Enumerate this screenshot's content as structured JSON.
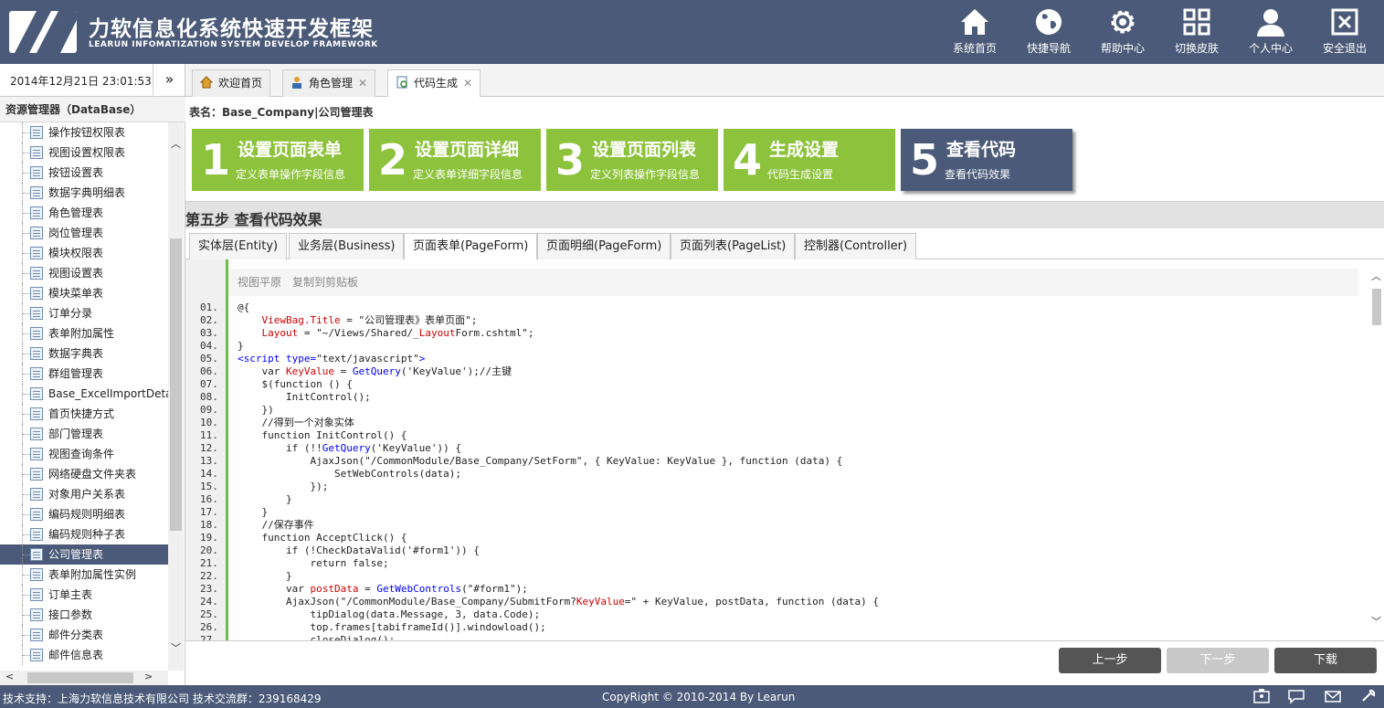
{
  "app": {
    "title": "力软信息化系统快速开发框架",
    "subtitle": "LEARUN INFOMATIZATION SYSTEM DEVELOP FRAMEWORK"
  },
  "nav": [
    {
      "label": "系统首页",
      "icon": "home-icon"
    },
    {
      "label": "快捷导航",
      "icon": "globe-icon"
    },
    {
      "label": "帮助中心",
      "icon": "gear-icon"
    },
    {
      "label": "切换皮肤",
      "icon": "grid-icon"
    },
    {
      "label": "个人中心",
      "icon": "user-icon"
    },
    {
      "label": "安全退出",
      "icon": "close-box-icon"
    }
  ],
  "datetime": "2014年12月21日 23:01:53",
  "toggle_glyph": "»",
  "tabs": [
    {
      "label": "欢迎首页",
      "icon": "home-icon",
      "closable": false
    },
    {
      "label": "角色管理",
      "icon": "user-icon",
      "closable": true
    },
    {
      "label": "代码生成",
      "icon": "code-doc-icon",
      "closable": true,
      "active": true
    }
  ],
  "sidebar": {
    "title": "资源管理器（DataBase）",
    "items": [
      "操作按钮权限表",
      "视图设置权限表",
      "按钮设置表",
      "数据字典明细表",
      "角色管理表",
      "岗位管理表",
      "模块权限表",
      "视图设置表",
      "模块菜单表",
      "订单分录",
      "表单附加属性",
      "数据字典表",
      "群组管理表",
      "Base_ExcelImportDetai",
      "首页快捷方式",
      "部门管理表",
      "视图查询条件",
      "网络硬盘文件夹表",
      "对象用户关系表",
      "编码规则明细表",
      "编码规则种子表",
      "公司管理表",
      "表单附加属性实例",
      "订单主表",
      "接口参数",
      "邮件分类表",
      "邮件信息表"
    ],
    "selected_index": 21
  },
  "main": {
    "table_name": "表名：Base_Company|公司管理表",
    "steps": [
      {
        "num": "1",
        "title": "设置页面表单",
        "desc": "定义表单操作字段信息"
      },
      {
        "num": "2",
        "title": "设置页面详细",
        "desc": "定义表单详细字段信息"
      },
      {
        "num": "3",
        "title": "设置页面列表",
        "desc": "定义列表操作字段信息"
      },
      {
        "num": "4",
        "title": "生成设置",
        "desc": "代码生成设置"
      },
      {
        "num": "5",
        "title": "查看代码",
        "desc": "查看代码效果"
      }
    ],
    "current_step": "第五步 查看代码效果",
    "code_tabs": [
      "实体层(Entity)",
      "业务层(Business)",
      "页面表单(PageForm)",
      "页面明细(PageForm)",
      "页面列表(PageList)",
      "控制器(Controller)"
    ],
    "active_code_tab": 2,
    "code_tools": {
      "view_plain": "视图平原",
      "copy": "复制到剪贴板"
    },
    "code_lines": [
      "@{",
      "    ViewBag.Title = \"公司管理表》表单页面\";",
      "    Layout = \"~/Views/Shared/_LayoutForm.cshtml\";",
      "}",
      "<script type=\"text/javascript\">",
      "    var KeyValue = GetQuery('KeyValue');//主键",
      "    $(function () {",
      "        InitControl();",
      "    })",
      "    //得到一个对象实体",
      "    function InitControl() {",
      "        if (!!GetQuery('KeyValue')) {",
      "            AjaxJson(\"/CommonModule/Base_Company/SetForm\", { KeyValue: KeyValue }, function (data) {",
      "                SetWebControls(data);",
      "            });",
      "        }",
      "    }",
      "    //保存事件",
      "    function AcceptClick() {",
      "        if (!CheckDataValid('#form1')) {",
      "            return false;",
      "        }",
      "        var postData = GetWebControls(\"#form1\");",
      "        AjaxJson(\"/CommonModule/Base_Company/SubmitForm?KeyValue=\" + KeyValue, postData, function (data) {",
      "            tipDialog(data.Message, 3, data.Code);",
      "            top.frames[tabiframeId()].windowload();",
      "            closeDialog();"
    ],
    "buttons": {
      "prev": "上一步",
      "next": "下一步",
      "download": "下载"
    }
  },
  "footer": {
    "support": "技术支持：上海力软信息技术有限公司   技术交流群：239168429",
    "copyright": "CopyRight © 2010-2014 By Learun"
  },
  "colors": {
    "header": "#4a5a78",
    "step_green": "#8dc33c",
    "step_current": "#4a5a78",
    "btn_dark": "#555555",
    "btn_disabled": "#c8c8c8"
  }
}
